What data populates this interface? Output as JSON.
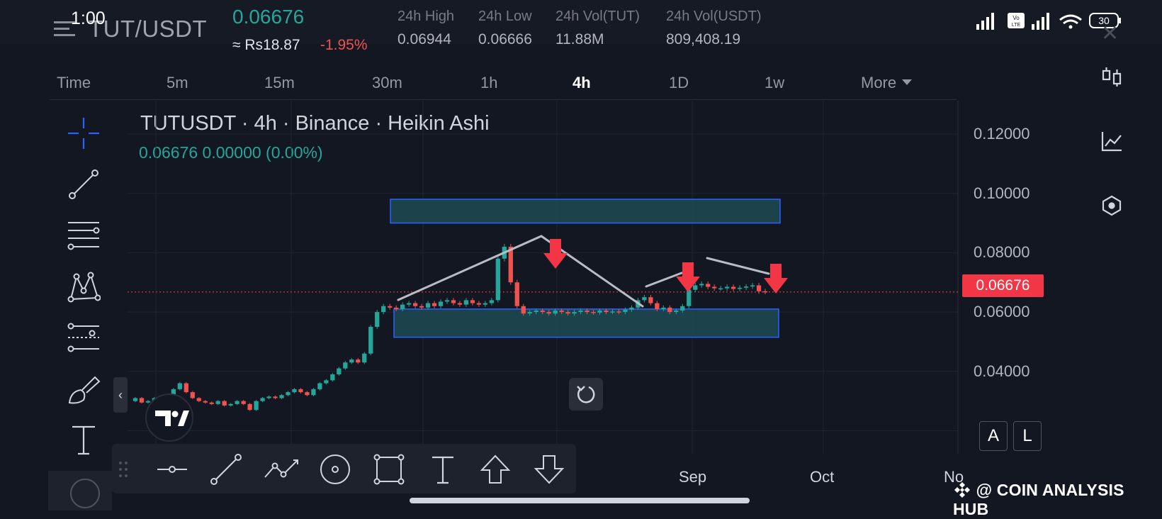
{
  "status_bar": {
    "time": "1:00",
    "battery": "30"
  },
  "header": {
    "pair": "TUT/USDT",
    "last_price": "0.06676",
    "price_local": "≈ Rs18.87",
    "change_pct": "-1.95%",
    "stats": [
      {
        "label": "24h High",
        "value": "0.06944"
      },
      {
        "label": "24h Low",
        "value": "0.06666"
      },
      {
        "label": "24h Vol(TUT)",
        "value": "11.88M"
      },
      {
        "label": "24h Vol(USDT)",
        "value": "809,408.19"
      }
    ]
  },
  "timeframes": {
    "items": [
      "Time",
      "5m",
      "15m",
      "30m",
      "1h",
      "4h",
      "1D",
      "1w"
    ],
    "active": "4h",
    "more": "More"
  },
  "chart": {
    "legend_title": "TUTUSDT · 4h · Binance · Heikin Ashi",
    "legend_values": "0.06676  0.00000 (0.00%)",
    "current_price_tag": "0.06676",
    "colors": {
      "up": "#26a69a",
      "down": "#ef5350",
      "zone_fill": "#1e4a52",
      "zone_border": "#2962ff",
      "trendline": "#b9bcc6",
      "arrow": "#f23645"
    }
  },
  "chart_data": {
    "type": "line",
    "title": "TUTUSDT · 4h · Binance · Heikin Ashi",
    "yticks": [
      "0.12000",
      "0.10000",
      "0.08000",
      "0.06000",
      "0.04000"
    ],
    "ylim": [
      0.02,
      0.125
    ],
    "xticks": [
      "Sep",
      "Oct",
      "No"
    ],
    "grid": true,
    "series": [
      {
        "values": [
          0.03,
          0.031,
          0.0295,
          0.03,
          0.031,
          0.0305,
          0.032,
          0.034,
          0.036,
          0.033,
          0.031,
          0.03,
          0.0295,
          0.029,
          0.03,
          0.0285,
          0.029,
          0.03,
          0.029,
          0.027,
          0.03,
          0.031,
          0.0315,
          0.031,
          0.032,
          0.033,
          0.034,
          0.033,
          0.032,
          0.034,
          0.036,
          0.037,
          0.039,
          0.041,
          0.043,
          0.044,
          0.043,
          0.046,
          0.055,
          0.06,
          0.062,
          0.0615,
          0.061,
          0.0625,
          0.063,
          0.062,
          0.0615,
          0.063,
          0.062,
          0.0635,
          0.064,
          0.063,
          0.0625,
          0.064,
          0.063,
          0.0625,
          0.063,
          0.064,
          0.078,
          0.082,
          0.07,
          0.062,
          0.0595,
          0.06,
          0.0605,
          0.06,
          0.0595,
          0.0605,
          0.06,
          0.0595,
          0.06,
          0.0605,
          0.06,
          0.0598,
          0.0605,
          0.06,
          0.0602,
          0.06,
          0.0608,
          0.0615,
          0.064,
          0.065,
          0.063,
          0.061,
          0.0615,
          0.06,
          0.0605,
          0.062,
          0.0675,
          0.069,
          0.0695,
          0.0685,
          0.068,
          0.068,
          0.0685,
          0.0678,
          0.0682,
          0.0686,
          0.069,
          0.067,
          0.0668
        ]
      }
    ],
    "annotations": {
      "zones": [
        {
          "name": "resistance-zone",
          "y0": 0.09,
          "y1": 0.098
        },
        {
          "name": "support-zone",
          "y0": 0.0515,
          "y1": 0.061
        }
      ],
      "current_price": 0.06676
    }
  },
  "scale_buttons": {
    "auto": "A",
    "log": "L"
  },
  "watermark": "@ COIN ANALYSIS HUB",
  "icons": {
    "topbar": [
      "menu-icon",
      "close-icon"
    ],
    "right_rail": [
      "candle-type-icon",
      "indicators-icon",
      "object-tree-icon"
    ],
    "left_tools": [
      "crosshair-icon",
      "trend-line-icon",
      "fib-retracement-icon",
      "pattern-icon",
      "prediction-icon",
      "brush-icon",
      "text-icon"
    ],
    "drawing_bar": [
      "drag-handle-icon",
      "horizontal-ray-icon",
      "trend-line-icon",
      "path-icon",
      "circle-tool-icon",
      "rectangle-tool-icon",
      "text-tool-icon",
      "arrow-up-icon",
      "arrow-down-icon"
    ]
  }
}
